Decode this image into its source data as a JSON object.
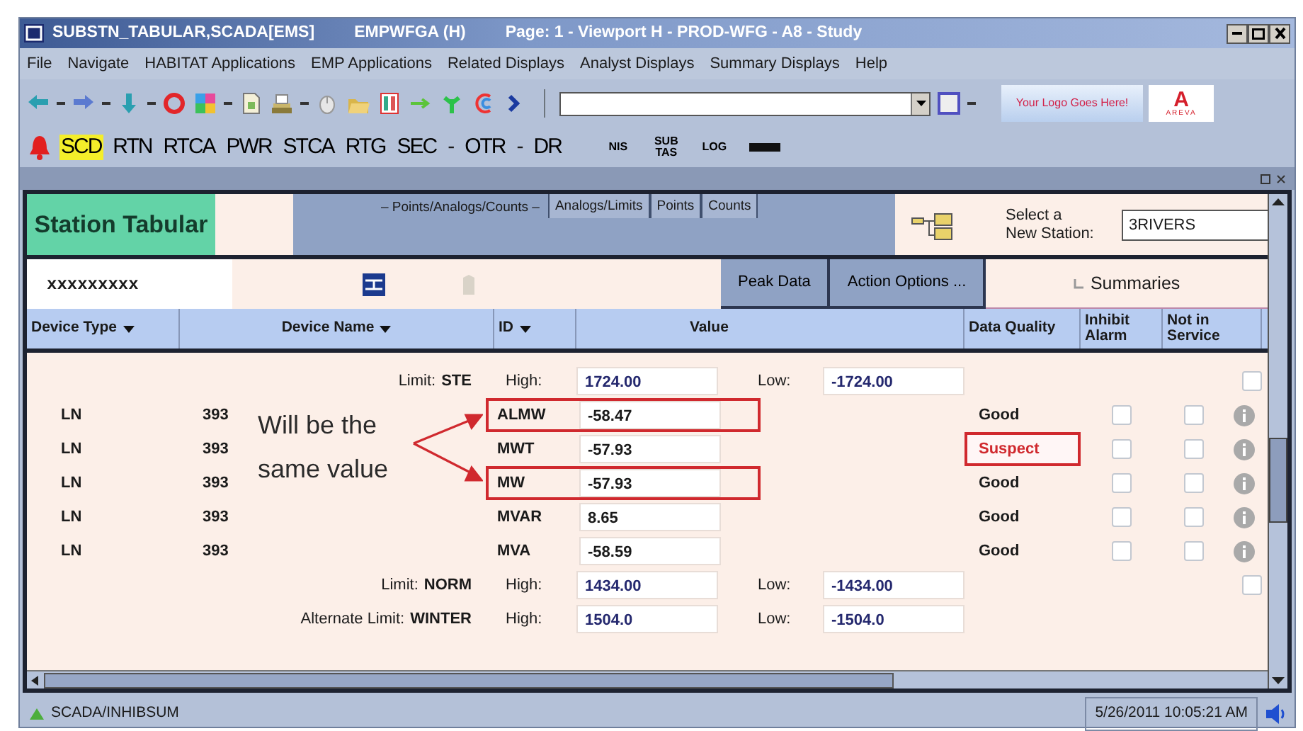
{
  "window": {
    "title_parts": [
      "SUBSTN_TABULAR,SCADA[EMS]",
      "EMPWFGA (H)",
      "Page: 1  - Viewport H - PROD-WFG - A8 - Study"
    ]
  },
  "menu": [
    "File",
    "Navigate",
    "HABITAT Applications",
    "EMP Applications",
    "Related Displays",
    "Analyst Displays",
    "Summary Displays",
    "Help"
  ],
  "toolbar": {
    "logo_text": "Your Logo Goes Here!",
    "brand_mark": "A",
    "brand_name": "AREVA"
  },
  "app_bar": {
    "items": [
      {
        "kind": "app",
        "label": "SCD",
        "selected": true
      },
      {
        "kind": "app",
        "label": "RTN",
        "selected": false
      },
      {
        "kind": "app",
        "label": "RTCA",
        "selected": false
      },
      {
        "kind": "app",
        "label": "PWR",
        "selected": false
      },
      {
        "kind": "app",
        "label": "STCA",
        "selected": false
      },
      {
        "kind": "app",
        "label": "RTG",
        "selected": false
      },
      {
        "kind": "app",
        "label": "SEC",
        "selected": false
      },
      {
        "kind": "sep",
        "label": "-"
      },
      {
        "kind": "app",
        "label": "OTR",
        "selected": false
      },
      {
        "kind": "sep",
        "label": "-"
      },
      {
        "kind": "app",
        "label": "DR",
        "selected": false
      }
    ],
    "small_items": [
      "NIS",
      "SUB TAS",
      "LOG"
    ]
  },
  "station": {
    "title": "Station Tabular",
    "tab_group_label": "– Points/Analogs/Counts –",
    "tabs": [
      {
        "label": "Analogs/Limits",
        "selected": false
      },
      {
        "label": "Points",
        "selected": false
      },
      {
        "label": "Counts",
        "selected": false
      }
    ],
    "select_label": "Select a\nNew Station:",
    "station_value": "3RIVERS",
    "filter_value": "xxxxxxxxx",
    "buttons": [
      "Peak Data",
      "Action Options ..."
    ],
    "summaries_label": "Summaries"
  },
  "table": {
    "columns": [
      {
        "label": "Device Type",
        "sortable": true
      },
      {
        "label": "Device Name",
        "sortable": true
      },
      {
        "label": "ID",
        "sortable": true
      },
      {
        "label": "Value",
        "sortable": false
      },
      {
        "label": "Data Quality",
        "sortable": false
      },
      {
        "label": "Inhibit Alarm",
        "sortable": false
      },
      {
        "label": "Not in Service",
        "sortable": false
      }
    ],
    "rows": [
      {
        "kind": "limit",
        "limit_label": "Limit:",
        "limit_name": "STE",
        "high_label": "High:",
        "high": "1724.00",
        "low_label": "Low:",
        "low": "-1724.00",
        "checked": false
      },
      {
        "kind": "device",
        "device_type": "LN",
        "device_name": "393",
        "id": "ALMW",
        "value": "-58.47",
        "highlighted": true,
        "quality": "Good",
        "quality_flag": false,
        "inhibit_alarm": false,
        "not_in_service": false
      },
      {
        "kind": "device",
        "device_type": "LN",
        "device_name": "393",
        "id": "MWT",
        "value": "-57.93",
        "highlighted": false,
        "quality": "Suspect",
        "quality_flag": true,
        "inhibit_alarm": false,
        "not_in_service": false
      },
      {
        "kind": "device",
        "device_type": "LN",
        "device_name": "393",
        "id": "MW",
        "value": "-57.93",
        "highlighted": true,
        "quality": "Good",
        "quality_flag": false,
        "inhibit_alarm": false,
        "not_in_service": false
      },
      {
        "kind": "device",
        "device_type": "LN",
        "device_name": "393",
        "id": "MVAR",
        "value": "8.65",
        "highlighted": false,
        "quality": "Good",
        "quality_flag": false,
        "inhibit_alarm": false,
        "not_in_service": false
      },
      {
        "kind": "device",
        "device_type": "LN",
        "device_name": "393",
        "id": "MVA",
        "value": "-58.59",
        "highlighted": false,
        "quality": "Good",
        "quality_flag": false,
        "inhibit_alarm": false,
        "not_in_service": false
      },
      {
        "kind": "limit",
        "limit_label": "Limit:",
        "limit_name": "NORM",
        "high_label": "High:",
        "high": "1434.00",
        "low_label": "Low:",
        "low": "-1434.00",
        "checked": false
      },
      {
        "kind": "limit",
        "limit_label": "Alternate Limit:",
        "limit_name": "WINTER",
        "high_label": "High:",
        "high": "1504.0",
        "low_label": "Low:",
        "low": "-1504.0"
      }
    ]
  },
  "annotation": {
    "text": "Will be the same value"
  },
  "status_bar": {
    "path": "SCADA/INHIBSUM",
    "datetime": "5/26/2011 10:05:21 AM"
  }
}
